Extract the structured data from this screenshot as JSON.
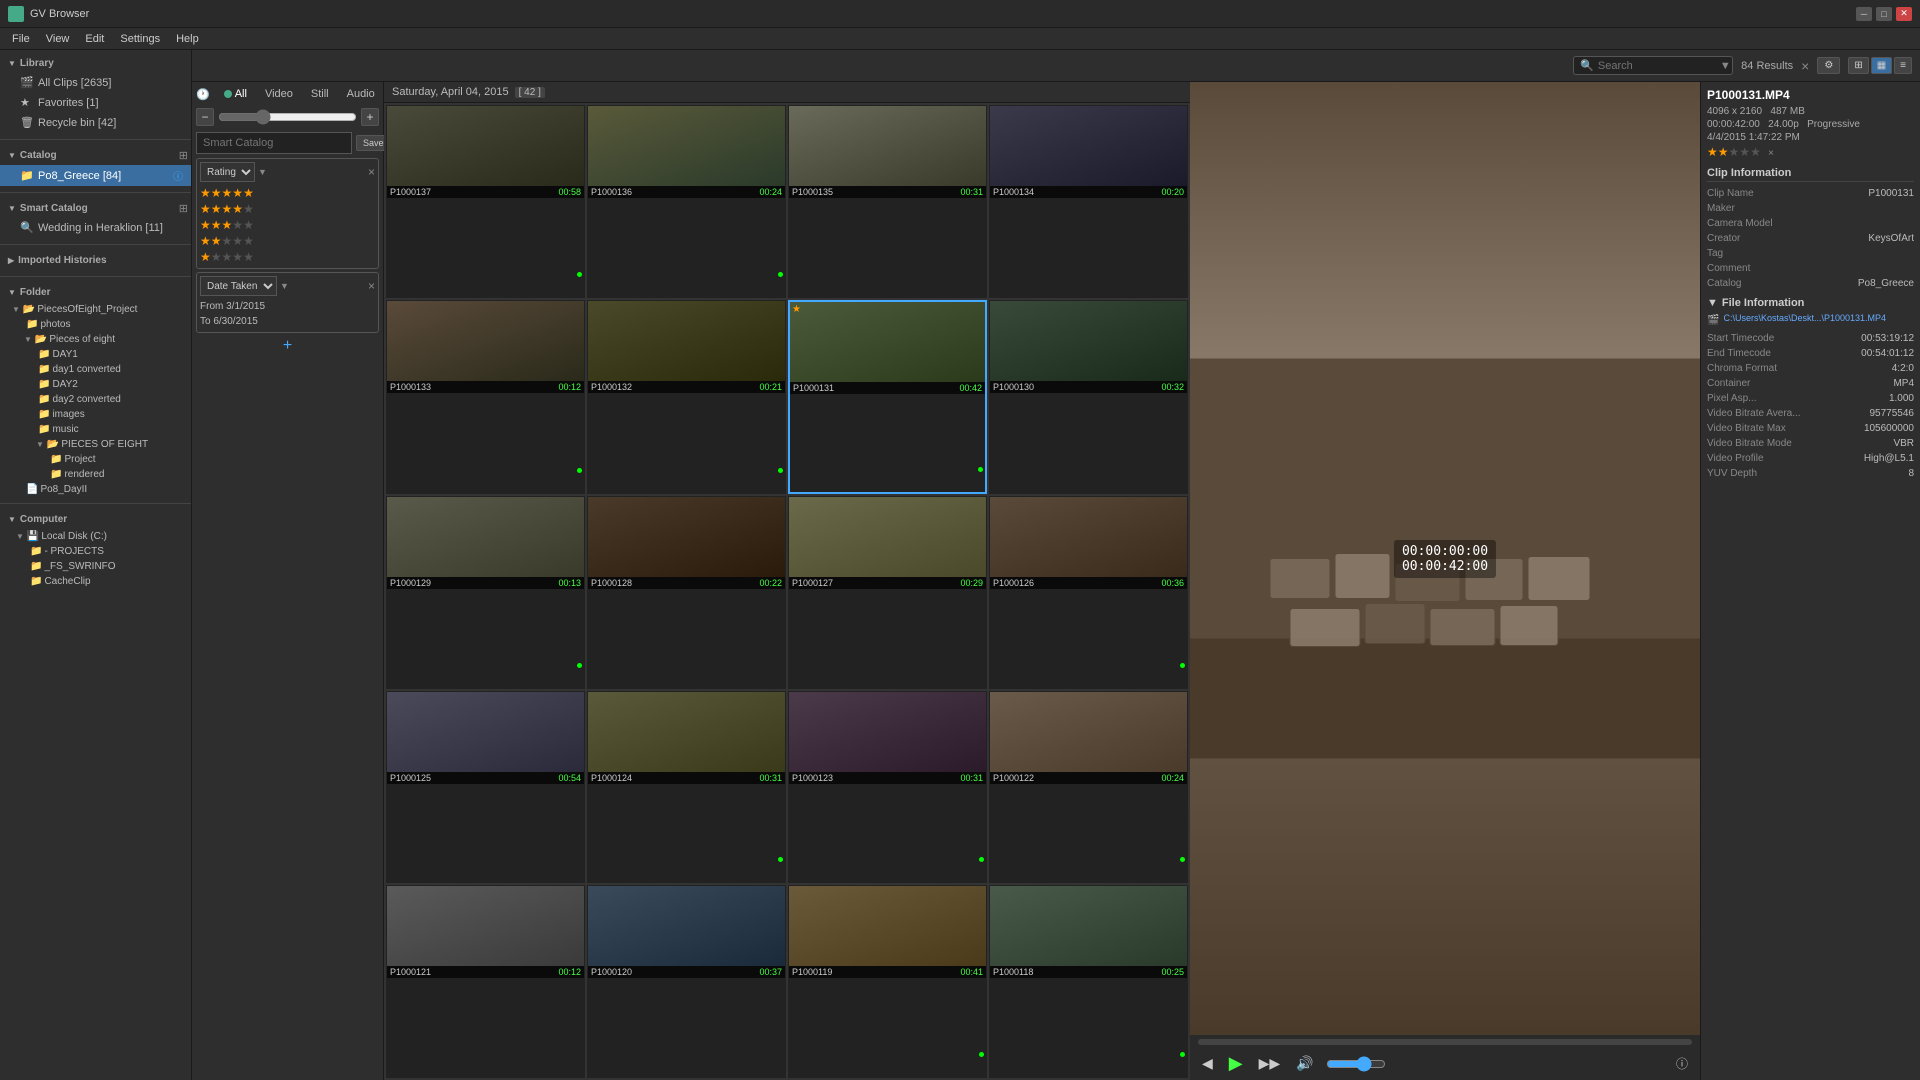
{
  "app": {
    "title": "GV Browser",
    "menu": [
      "File",
      "View",
      "Edit",
      "Settings",
      "Help"
    ]
  },
  "toolbar": {
    "search_placeholder": "Search",
    "results_count": "84 Results",
    "clear_btn": "×",
    "settings_icon": "⚙",
    "view_grid_icon": "▦",
    "view_list_icon": "☰",
    "view_detail_icon": "≡"
  },
  "filter": {
    "tabs": [
      "All",
      "Video",
      "Still",
      "Audio"
    ],
    "active_tab": "All",
    "smart_catalog_placeholder": "Smart Catalog",
    "save_btn": "Save as smart catalog",
    "rating_label": "Rating",
    "date_label": "Date Taken",
    "date_from": "From 3/1/2015",
    "date_to": "To 6/30/2015",
    "add_btn": "+"
  },
  "library": {
    "section_label": "Library",
    "items": [
      {
        "label": "All Clips [2635]",
        "icon": "clip"
      },
      {
        "label": "Favorites [1]",
        "icon": "star"
      },
      {
        "label": "Recycle bin [42]",
        "icon": "trash"
      }
    ],
    "catalog_label": "Catalog",
    "catalog_items": [
      {
        "label": "Po8_Greece [84]",
        "icon": "catalog",
        "active": true
      }
    ],
    "smart_catalog_label": "Smart Catalog",
    "smart_items": [
      {
        "label": "Wedding in Heraklion [11]",
        "icon": "smart"
      }
    ],
    "imported_label": "Imported Histories"
  },
  "folder": {
    "section_label": "Folder",
    "items": [
      {
        "label": "PiecesOfEight_Project",
        "level": 1,
        "icon": "folder"
      },
      {
        "label": "photos",
        "level": 2,
        "icon": "folder"
      },
      {
        "label": "Pieces of eight",
        "level": 2,
        "icon": "folder"
      },
      {
        "label": "DAY1",
        "level": 3,
        "icon": "folder"
      },
      {
        "label": "day1 converted",
        "level": 3,
        "icon": "folder"
      },
      {
        "label": "DAY2",
        "level": 3,
        "icon": "folder"
      },
      {
        "label": "day2 converted",
        "level": 3,
        "icon": "folder"
      },
      {
        "label": "images",
        "level": 3,
        "icon": "folder"
      },
      {
        "label": "music",
        "level": 3,
        "icon": "folder"
      },
      {
        "label": "PIECES OF EIGHT",
        "level": 3,
        "icon": "folder"
      },
      {
        "label": "Project",
        "level": 4,
        "icon": "folder"
      },
      {
        "label": "rendered",
        "level": 4,
        "icon": "folder"
      },
      {
        "label": "Po8_DayII",
        "level": 2,
        "icon": "file"
      }
    ],
    "computer_label": "Computer",
    "computer_items": [
      {
        "label": "Local Disk (C:)",
        "level": 1,
        "icon": "disk"
      },
      {
        "label": "- PROJECTS",
        "level": 2,
        "icon": "folder"
      },
      {
        "label": "_FS_SWRINFO",
        "level": 2,
        "icon": "folder"
      },
      {
        "label": "CacheClip",
        "level": 2,
        "icon": "folder"
      }
    ]
  },
  "media": {
    "date_header": "Saturday, April 04, 2015",
    "count": "42",
    "clips": [
      {
        "id": "P1000137",
        "duration": "00:58",
        "has_dot": true
      },
      {
        "id": "P1000136",
        "duration": "00:24",
        "has_dot": true
      },
      {
        "id": "P1000135",
        "duration": "00:31",
        "has_dot": false
      },
      {
        "id": "P1000134",
        "duration": "00:20",
        "has_dot": false
      },
      {
        "id": "P1000133",
        "duration": "00:12",
        "has_dot": true
      },
      {
        "id": "P1000132",
        "duration": "00:21",
        "has_dot": true
      },
      {
        "id": "P1000131",
        "duration": "00:42",
        "selected": true,
        "starred": true,
        "has_dot": true
      },
      {
        "id": "P1000130",
        "duration": "00:32",
        "has_dot": false
      },
      {
        "id": "P1000129",
        "duration": "00:13",
        "has_dot": true
      },
      {
        "id": "P1000128",
        "duration": "00:22",
        "has_dot": false
      },
      {
        "id": "P1000127",
        "duration": "00:29",
        "has_dot": false
      },
      {
        "id": "P1000126",
        "duration": "00:36",
        "has_dot": true
      },
      {
        "id": "P1000125",
        "duration": "00:54",
        "has_dot": false
      },
      {
        "id": "P1000124",
        "duration": "00:31",
        "has_dot": true
      },
      {
        "id": "P1000123",
        "duration": "00:31",
        "has_dot": true
      },
      {
        "id": "P1000122",
        "duration": "00:24",
        "has_dot": true
      },
      {
        "id": "P1000121",
        "duration": "00:12",
        "has_dot": false
      },
      {
        "id": "P1000120",
        "duration": "00:37",
        "has_dot": false
      },
      {
        "id": "P1000119",
        "duration": "00:41",
        "has_dot": true
      },
      {
        "id": "P1000118",
        "duration": "00:25",
        "has_dot": true
      }
    ]
  },
  "preview": {
    "timecode_start": "00:00:00:00",
    "timecode_duration": "00:00:42:00",
    "progress": 0
  },
  "info": {
    "filename": "P1000131.MP4",
    "resolution": "4096 x 2160",
    "filesize": "487 MB",
    "duration": "00:00:42:00",
    "framerate": "24.00p",
    "scan": "Progressive",
    "date": "4/4/2015 1:47:22 PM",
    "stars": 2,
    "clip_info_label": "Clip Information",
    "clip_name_label": "Clip Name",
    "clip_name": "P1000131",
    "maker_label": "Maker",
    "maker": "",
    "camera_label": "Camera Model",
    "camera": "",
    "creator_label": "Creator",
    "creator": "KeysOfArt",
    "tag_label": "Tag",
    "tag": "",
    "comment_label": "Comment",
    "comment": "",
    "catalog_label": "Catalog",
    "catalog": "Po8_Greece",
    "file_info_label": "File Information",
    "file_path": "C:\\Users\\Kostas\\Deskt...\\P1000131.MP4",
    "start_tc_label": "Start Timecode",
    "start_tc": "00:53:19:12",
    "end_tc_label": "End Timecode",
    "end_tc": "00:54:01:12",
    "chroma_label": "Chroma Format",
    "chroma": "4:2:0",
    "container_label": "Container",
    "container": "MP4",
    "pixel_asp_label": "Pixel Asp...",
    "pixel_asp": "1.000",
    "vbr_avg_label": "Video Bitrate Avera...",
    "vbr_avg": "95775546",
    "vbr_max_label": "Video Bitrate Max",
    "vbr_max": "105600000",
    "vbr_mode_label": "Video Bitrate Mode",
    "vbr_mode": "VBR",
    "profile_label": "Video Profile",
    "profile": "High@L5.1",
    "yuv_label": "YUV Depth",
    "yuv": "8"
  }
}
